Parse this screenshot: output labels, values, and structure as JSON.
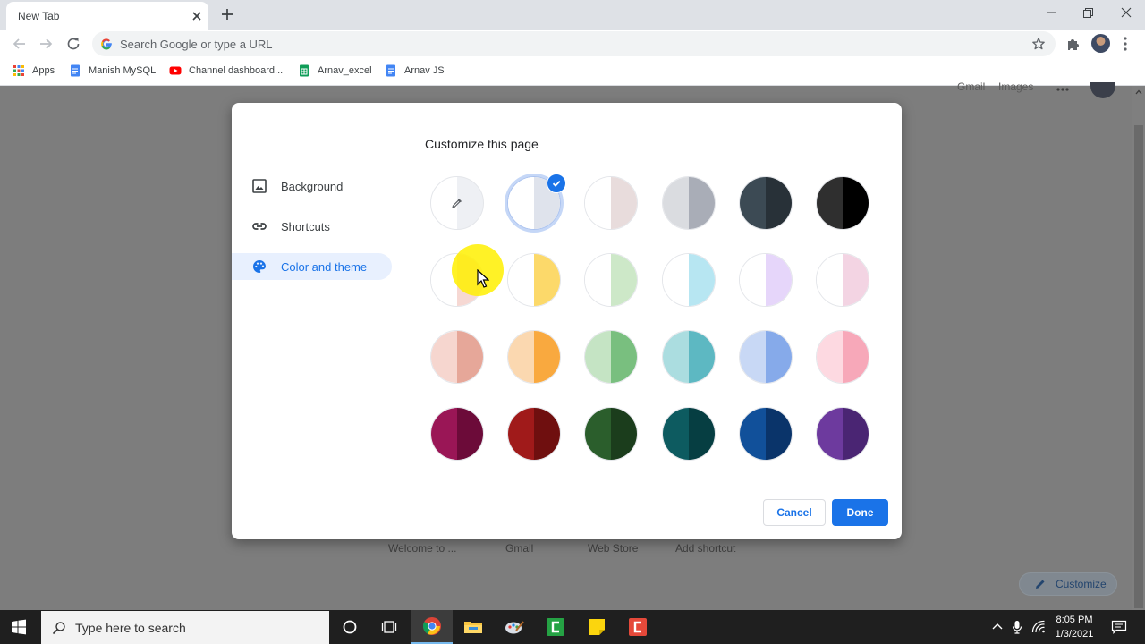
{
  "browser": {
    "tab_title": "New Tab",
    "omnibox_placeholder": "Search Google or type a URL",
    "bookmarks": [
      {
        "label": "Apps",
        "icon": "apps-grid-icon"
      },
      {
        "label": "Manish MySQL",
        "icon": "docs-icon"
      },
      {
        "label": "Channel dashboard...",
        "icon": "youtube-icon"
      },
      {
        "label": "Arnav_excel",
        "icon": "sheets-icon"
      },
      {
        "label": "Arnav JS",
        "icon": "docs-icon"
      }
    ]
  },
  "page": {
    "top_links": [
      "Gmail",
      "Images"
    ],
    "shortcut_labels": [
      "Welcome to ...",
      "Gmail",
      "Web Store",
      "Add shortcut"
    ],
    "customize_label": "Customize"
  },
  "dialog": {
    "title": "Customize this page",
    "nav": [
      {
        "label": "Background",
        "icon": "image-icon",
        "active": false
      },
      {
        "label": "Shortcuts",
        "icon": "link-icon",
        "active": false
      },
      {
        "label": "Color and theme",
        "icon": "palette-icon",
        "active": true
      }
    ],
    "themes": [
      {
        "left": "#ffffff",
        "right": "#eef0f4",
        "custom_picker": true
      },
      {
        "left": "#ffffff",
        "right": "#dfe3ec",
        "selected": true
      },
      {
        "left": "#ffffff",
        "right": "#e8dcdc"
      },
      {
        "left": "#dadce0",
        "right": "#a9adb7"
      },
      {
        "left": "#3c4a54",
        "right": "#283138"
      },
      {
        "left": "#2f2f2f",
        "right": "#000000"
      },
      {
        "left": "#ffffff",
        "right": "#f6d8d3"
      },
      {
        "left": "#ffffff",
        "right": "#fcd96a"
      },
      {
        "left": "#ffffff",
        "right": "#cde8c8"
      },
      {
        "left": "#ffffff",
        "right": "#b7e6f2"
      },
      {
        "left": "#ffffff",
        "right": "#e6d6fa"
      },
      {
        "left": "#ffffff",
        "right": "#f3d4e3"
      },
      {
        "left": "#f6d6cf",
        "right": "#e6a799"
      },
      {
        "left": "#fbd8b0",
        "right": "#f9a93f"
      },
      {
        "left": "#c5e4c4",
        "right": "#79bf7f"
      },
      {
        "left": "#abdde0",
        "right": "#5db8c2"
      },
      {
        "left": "#c8d8f5",
        "right": "#86aaea"
      },
      {
        "left": "#fdd9e1",
        "right": "#f7a8b9"
      },
      {
        "left": "#9a1656",
        "right": "#6c0b39"
      },
      {
        "left": "#a01a1a",
        "right": "#6f0f0f"
      },
      {
        "left": "#2b5e2c",
        "right": "#1b3d1c"
      },
      {
        "left": "#0d5b60",
        "right": "#063e42"
      },
      {
        "left": "#11509a",
        "right": "#0a346a"
      },
      {
        "left": "#6d3a9e",
        "right": "#4a2573"
      }
    ],
    "cancel_label": "Cancel",
    "done_label": "Done"
  },
  "taskbar": {
    "search_placeholder": "Type here to search",
    "time": "8:05 PM",
    "date": "1/3/2021"
  },
  "colors": {
    "accent": "#1a73e8",
    "active_nav_bg": "#e8f0fe"
  }
}
